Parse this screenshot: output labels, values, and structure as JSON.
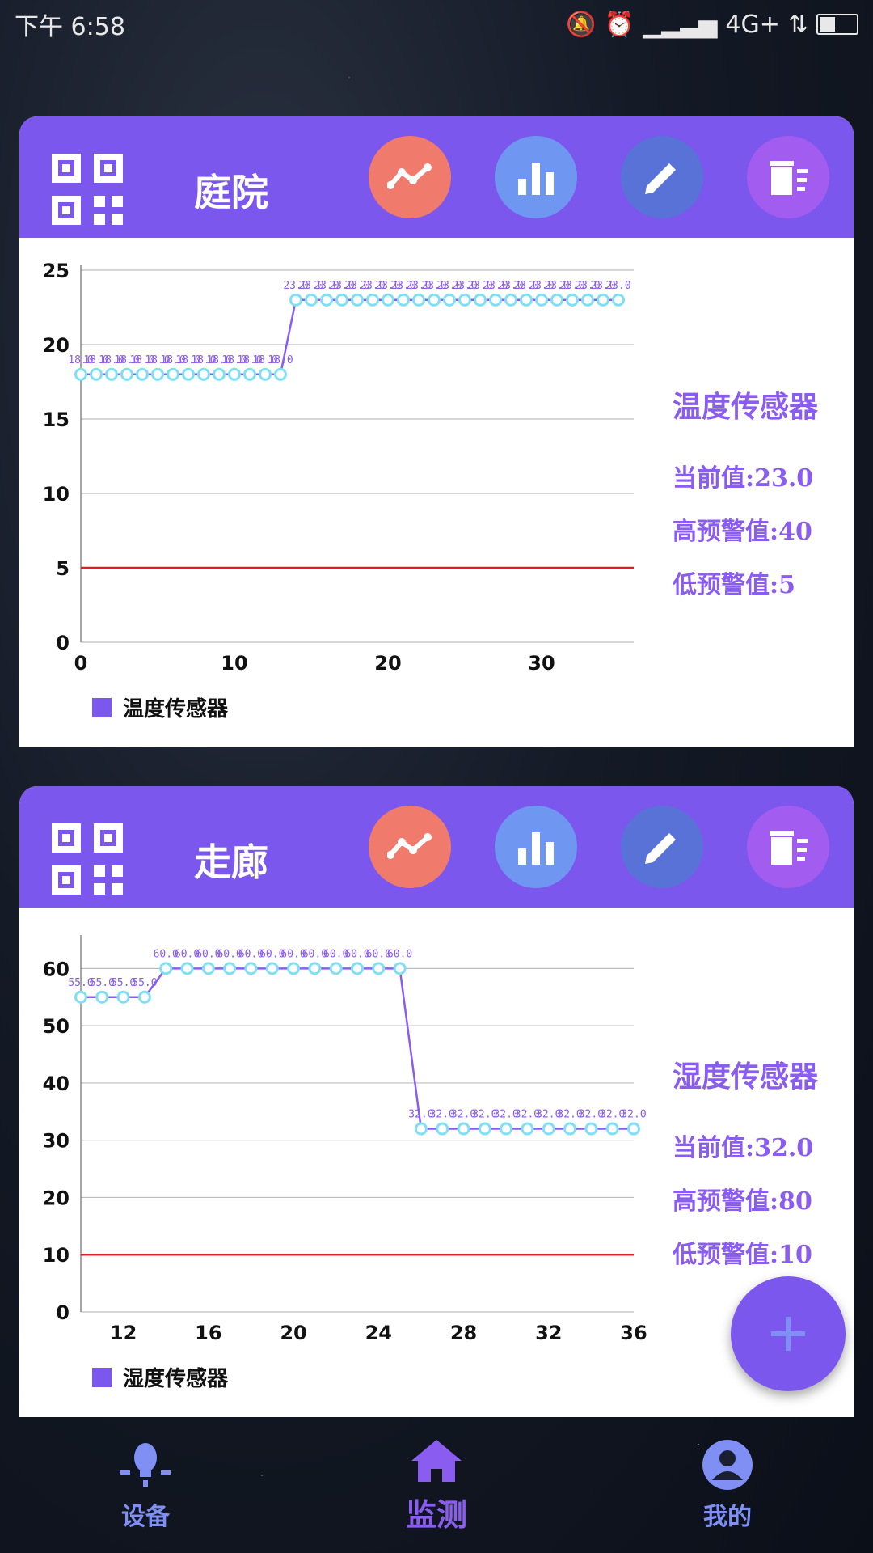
{
  "status_bar": {
    "time": "下午 6:58",
    "network": "4G+"
  },
  "cards": [
    {
      "title": "庭院",
      "legend": "温度传感器",
      "sensor_title": "温度传感器",
      "current": "当前值:23.0",
      "high": "高预警值:40",
      "low": "低预警值:5"
    },
    {
      "title": "走廊",
      "legend": "湿度传感器",
      "sensor_title": "湿度传感器",
      "current": "当前值:32.0",
      "high": "高预警值:80",
      "low": "低预警值:10"
    }
  ],
  "nav": {
    "device": "设备",
    "monitor": "监测",
    "mine": "我的"
  },
  "colors": {
    "accent": "#7c57ee",
    "line": "#8a5cf0",
    "marker": "#7fe0f5",
    "threshold": "#e02020"
  },
  "chart_data": [
    {
      "type": "line",
      "series": [
        {
          "name": "温度传感器",
          "x": [
            0,
            1,
            2,
            3,
            4,
            5,
            6,
            7,
            8,
            9,
            10,
            11,
            12,
            13,
            14,
            15,
            16,
            17,
            18,
            19,
            20,
            21,
            22,
            23,
            24,
            25,
            26,
            27,
            28,
            29,
            30,
            31,
            32,
            33,
            34,
            35
          ],
          "values": [
            18,
            18,
            18,
            18,
            18,
            18,
            18,
            18,
            18,
            18,
            18,
            18,
            18,
            18,
            23,
            23,
            23,
            23,
            23,
            23,
            23,
            23,
            23,
            23,
            23,
            23,
            23,
            23,
            23,
            23,
            23,
            23,
            23,
            23,
            23,
            23
          ]
        }
      ],
      "threshold": 5,
      "xlim": [
        0,
        36
      ],
      "ylim": [
        0,
        25
      ],
      "xticks": [
        "0",
        "10",
        "20",
        "30"
      ],
      "yticks": [
        "0",
        "5",
        "10",
        "15",
        "20",
        "25"
      ],
      "legend": "bottom-left"
    },
    {
      "type": "line",
      "series": [
        {
          "name": "湿度传感器",
          "x": [
            10,
            11,
            12,
            13,
            14,
            15,
            16,
            17,
            18,
            19,
            20,
            21,
            22,
            23,
            24,
            25,
            26,
            27,
            28,
            29,
            30,
            31,
            32,
            33,
            34,
            35,
            36
          ],
          "values": [
            55,
            55,
            55,
            55,
            60,
            60,
            60,
            60,
            60,
            60,
            60,
            60,
            60,
            60,
            60,
            60,
            32,
            32,
            32,
            32,
            32,
            32,
            32,
            32,
            32,
            32,
            32
          ]
        }
      ],
      "threshold": 10,
      "xlim": [
        10,
        36
      ],
      "ylim": [
        0,
        65
      ],
      "xticks": [
        "12",
        "16",
        "20",
        "24",
        "28",
        "32",
        "36"
      ],
      "yticks": [
        "0",
        "10",
        "20",
        "30",
        "40",
        "50",
        "60"
      ],
      "legend": "bottom-left"
    }
  ]
}
